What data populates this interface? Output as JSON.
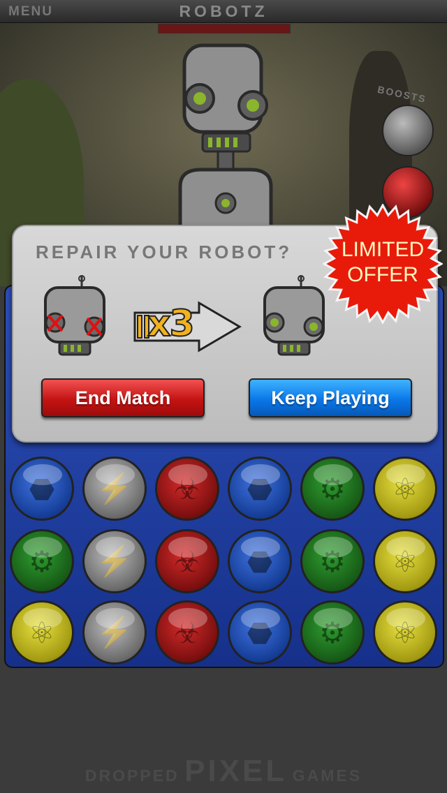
{
  "header": {
    "menu_label": "MENU",
    "title": "ROBOTZ"
  },
  "boosts": {
    "label": "BOOSTS"
  },
  "board": {
    "rows": [
      [
        "blue",
        "gray",
        "red",
        "blue",
        "green",
        "yellow"
      ],
      [
        "green",
        "gray",
        "red",
        "blue",
        "green",
        "yellow"
      ],
      [
        "yellow",
        "gray",
        "red",
        "blue",
        "green",
        "yellow"
      ]
    ]
  },
  "modal": {
    "title": "REPAIR YOUR ROBOT?",
    "multiplier": "x3",
    "end_label": "End Match",
    "keep_label": "Keep Playing"
  },
  "offer": {
    "line1": "LIMITED",
    "line2": "OFFER"
  },
  "footer": {
    "dropped": "DROPPED",
    "pixel": "PIXEL",
    "games": "GAMES"
  },
  "colors": {
    "accent_red": "#c41313",
    "accent_blue": "#0a77e8",
    "offer_red": "#e81b0b"
  }
}
